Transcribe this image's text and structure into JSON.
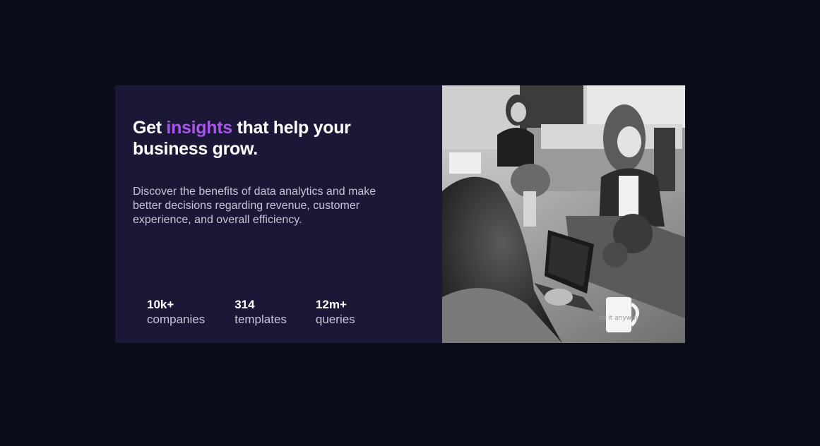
{
  "headline": {
    "prefix": "Get ",
    "accent": "insights",
    "suffix": " that help your business grow."
  },
  "description": "Discover the benefits of data analytics and make better decisions regarding revenue, customer experience, and overall efficiency.",
  "stats": [
    {
      "value": "10k+",
      "label": "companies"
    },
    {
      "value": "314",
      "label": "templates"
    },
    {
      "value": "12m+",
      "label": "queries"
    }
  ],
  "image": {
    "mug_text": "do it anyway"
  },
  "colors": {
    "background": "#0b0e1a",
    "card": "#1b1837",
    "accent": "#a855e8",
    "text_primary": "#ffffff",
    "text_secondary": "#c6c4d6"
  }
}
